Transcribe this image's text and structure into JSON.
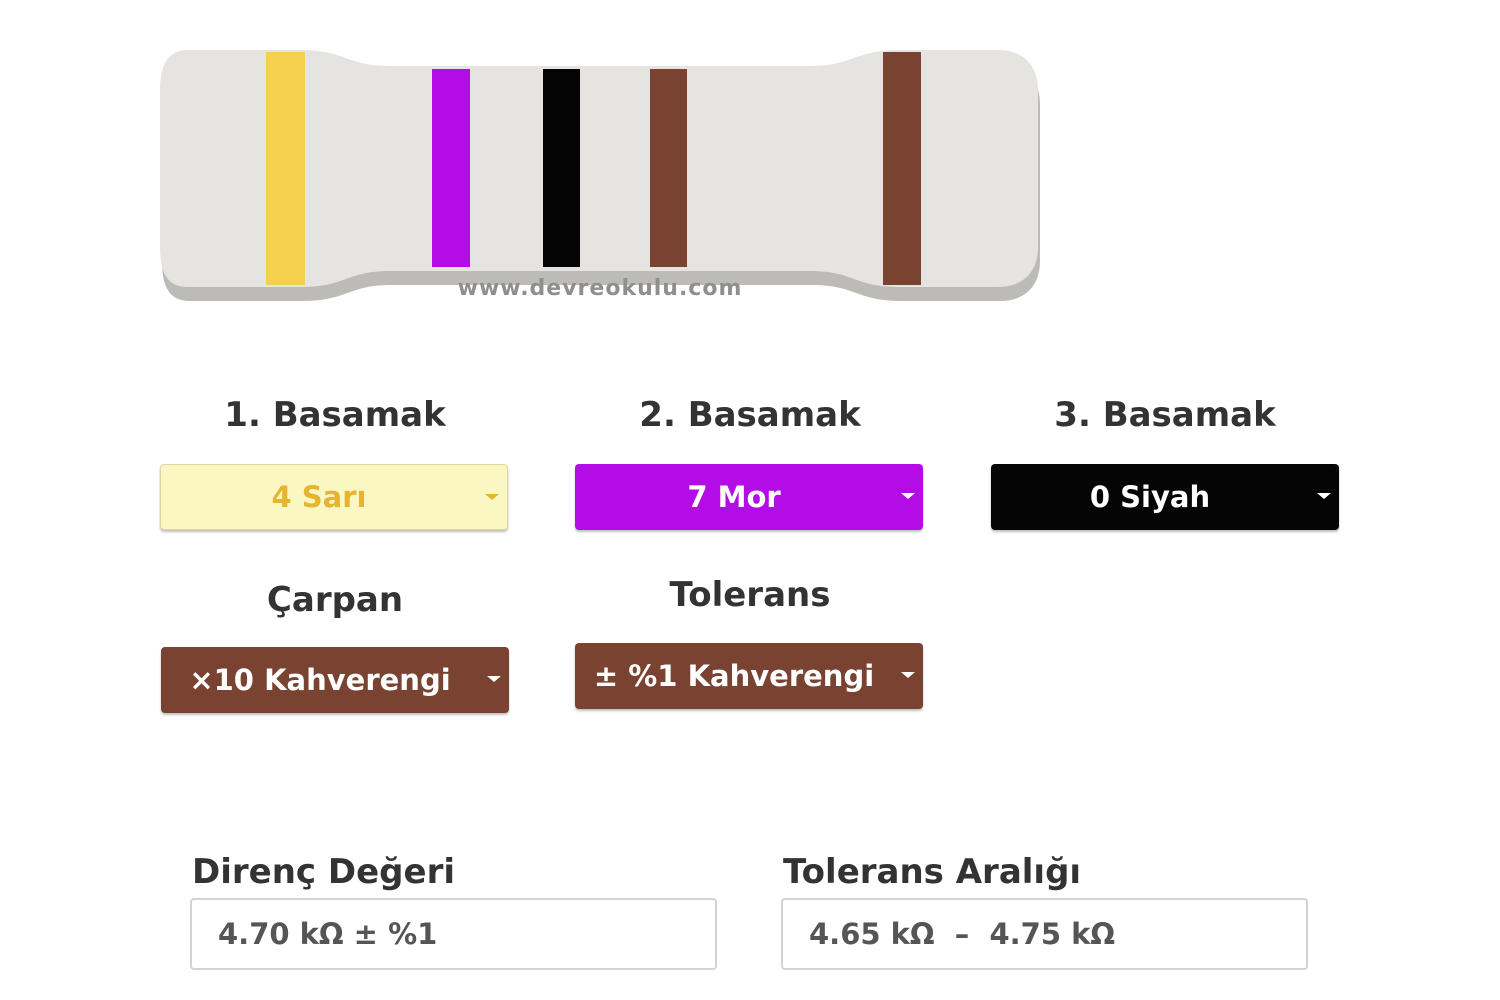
{
  "resistor": {
    "watermark": "www.devreokulu.com",
    "body_color": "#e6e4e1",
    "bands": [
      {
        "name": "band-1",
        "color": "#f5d04e"
      },
      {
        "name": "band-2",
        "color": "#b40ce6"
      },
      {
        "name": "band-3",
        "color": "#050505"
      },
      {
        "name": "band-multiplier",
        "color": "#7a4231"
      },
      {
        "name": "band-tolerance",
        "color": "#7a4231"
      }
    ]
  },
  "digits": {
    "first": {
      "label": "1. Basamak",
      "value": "4 Sarı",
      "color": "#f5d04e"
    },
    "second": {
      "label": "2. Basamak",
      "value": "7 Mor",
      "color": "#b40ce6"
    },
    "third": {
      "label": "3. Basamak",
      "value": "0 Siyah",
      "color": "#050505"
    }
  },
  "multiplier": {
    "label": "Çarpan",
    "value": "×10 Kahverengi",
    "color": "#7a4231"
  },
  "tolerance": {
    "label": "Tolerans",
    "value": "± %1 Kahverengi",
    "color": "#7a4231"
  },
  "result": {
    "resistance_label": "Direnç Değeri",
    "resistance_value": "4.70 kΩ ± %1",
    "range_label": "Tolerans Aralığı",
    "range_value": "4.65 kΩ  –  4.75 kΩ"
  }
}
